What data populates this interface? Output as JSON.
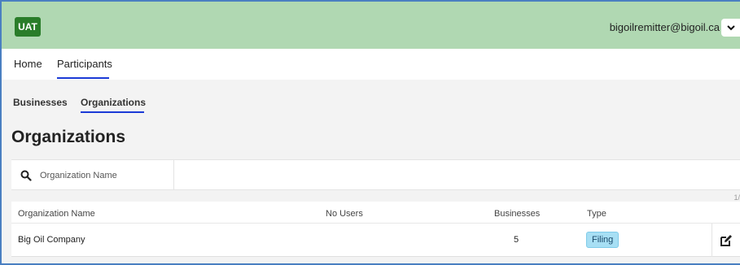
{
  "header": {
    "env_badge": "UAT",
    "user_email": "bigoilremitter@bigoil.ca",
    "accent_color": "#b0d8b2",
    "badge_color": "#2a7d2a"
  },
  "nav": {
    "items": [
      {
        "label": "Home",
        "active": false
      },
      {
        "label": "Participants",
        "active": true
      }
    ]
  },
  "subtabs": {
    "items": [
      {
        "label": "Businesses",
        "active": false
      },
      {
        "label": "Organizations",
        "active": true
      }
    ]
  },
  "page": {
    "title": "Organizations"
  },
  "search": {
    "placeholder": "Organization Name",
    "value": "",
    "icon": "search-icon"
  },
  "pagination": {
    "text": "1/"
  },
  "table": {
    "columns": [
      "Organization Name",
      "No Users",
      "Businesses",
      "Type"
    ],
    "rows": [
      {
        "name": "Big Oil Company",
        "users": "",
        "businesses": "5",
        "type": "Filing",
        "action_icon": "edit-icon"
      }
    ]
  }
}
